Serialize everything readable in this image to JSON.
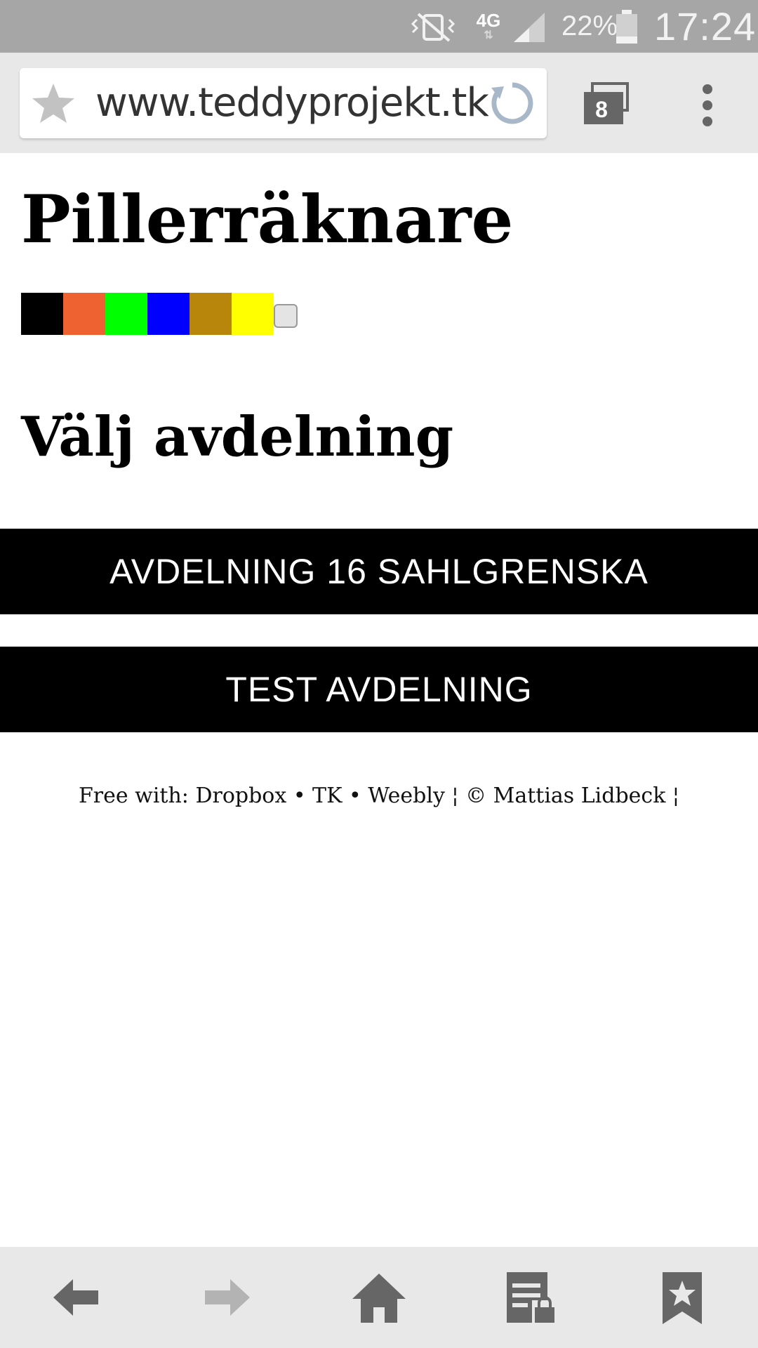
{
  "status_bar": {
    "network": "4G",
    "battery_percent": "22%",
    "time": "17:24",
    "icons": [
      "vibrate-icon",
      "signal-icon",
      "battery-icon"
    ]
  },
  "browser": {
    "url": "www.teddyprojekt.tk/",
    "tab_count": "8",
    "icons": [
      "star-icon",
      "reload-icon",
      "tabs-icon",
      "overflow-menu-icon"
    ]
  },
  "page": {
    "title": "Pillerräknare",
    "color_swatches": [
      "#000000",
      "#ee6130",
      "#00ff00",
      "#0000ff",
      "#b8860b",
      "#ffff00"
    ],
    "section_title": "Välj avdelning",
    "departments": [
      {
        "label": "AVDELNING 16 SAHLGRENSKA"
      },
      {
        "label": "TEST AVDELNING"
      }
    ],
    "footer": "Free with: Dropbox • TK • Weebly ¦ © Mattias Lidbeck ¦"
  },
  "bottom_nav": {
    "icons": [
      "back-icon",
      "forward-icon",
      "home-icon",
      "saved-pages-icon",
      "bookmarks-icon"
    ]
  }
}
